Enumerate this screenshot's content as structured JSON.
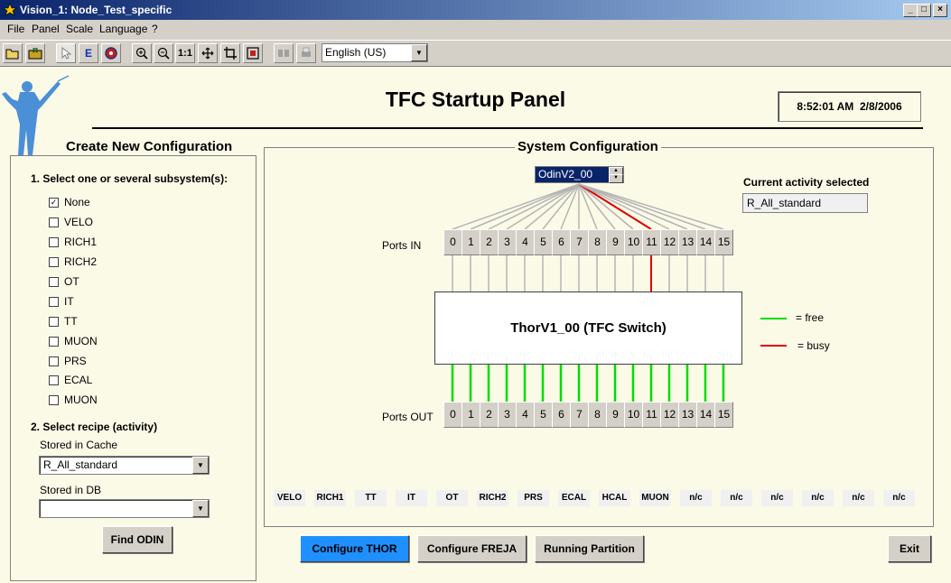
{
  "window": {
    "title": "Vision_1: Node_Test_specific",
    "minimize": "_",
    "maximize": "□",
    "close": "×"
  },
  "menu": {
    "items": [
      {
        "label": "File"
      },
      {
        "label": "Panel"
      },
      {
        "label": "Scale"
      },
      {
        "label": "Language"
      },
      {
        "label": "?"
      }
    ]
  },
  "toolbar": {
    "language": "English (US)",
    "zoom_one_to_one": "1:1"
  },
  "page": {
    "title": "TFC Startup Panel",
    "clock_time": "8:52:01 AM",
    "clock_date": "2/8/2006"
  },
  "left": {
    "title": "Create New Configuration",
    "step1": "1. Select one or several subsystem(s):",
    "subsystems": [
      {
        "label": "None",
        "checked": true
      },
      {
        "label": "VELO",
        "checked": false
      },
      {
        "label": "RICH1",
        "checked": false
      },
      {
        "label": "RICH2",
        "checked": false
      },
      {
        "label": "OT",
        "checked": false
      },
      {
        "label": "IT",
        "checked": false
      },
      {
        "label": "TT",
        "checked": false
      },
      {
        "label": "MUON",
        "checked": false
      },
      {
        "label": "PRS",
        "checked": false
      },
      {
        "label": "ECAL",
        "checked": false
      },
      {
        "label": "MUON",
        "checked": false
      }
    ],
    "step2": "2. Select recipe (activity)",
    "cache_label": "Stored in Cache",
    "cache_value": "R_All_standard",
    "db_label": "Stored in DB",
    "db_value": "",
    "find_button": "Find ODIN"
  },
  "system": {
    "title": "System Configuration",
    "odin_value": "OdinV2_00",
    "current_activity_label": "Current activity selected",
    "current_activity": "R_All_standard",
    "ports_in_label": "Ports IN",
    "ports_out_label": "Ports OUT",
    "ports": [
      "0",
      "1",
      "2",
      "3",
      "4",
      "5",
      "6",
      "7",
      "8",
      "9",
      "10",
      "11",
      "12",
      "13",
      "14",
      "15"
    ],
    "busy_in_port": 11,
    "switch_label": "ThorV1_00 (TFC Switch)",
    "legend_free": "= free",
    "legend_busy": "= busy",
    "colors": {
      "free": "#00dd00",
      "busy": "#dd0000",
      "idle": "#b4b4b4"
    },
    "subsystem_slots": [
      "VELO",
      "RICH1",
      "TT",
      "IT",
      "OT",
      "RICH2",
      "PRS",
      "ECAL",
      "HCAL",
      "MUON",
      "n/c",
      "n/c",
      "n/c",
      "n/c",
      "n/c",
      "n/c"
    ]
  },
  "actions": {
    "configure_thor": "Configure THOR",
    "configure_freja": "Configure FREJA",
    "running_partition": "Running Partition",
    "exit": "Exit"
  }
}
